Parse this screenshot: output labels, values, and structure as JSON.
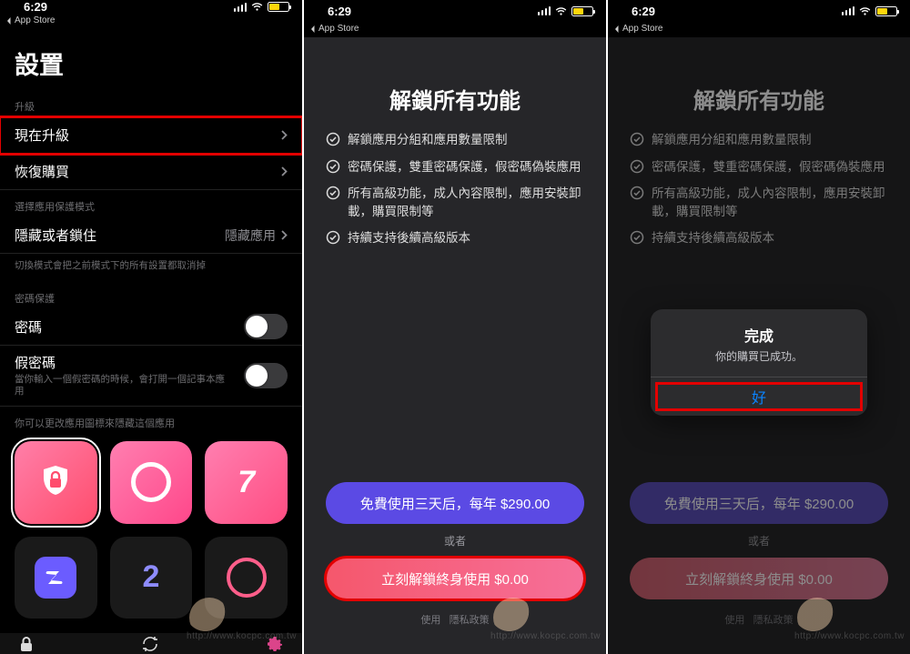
{
  "statusbar": {
    "time": "6:29",
    "back": "App Store"
  },
  "settings": {
    "title": "設置",
    "section_upgrade": "升級",
    "upgrade_now": "現在升級",
    "restore_purchase": "恢復購買",
    "section_mode": "選擇應用保護模式",
    "mode_label": "隱藏或者鎖住",
    "mode_value": "隱藏應用",
    "mode_footnote": "切換模式會把之前模式下的所有設置都取消掉",
    "section_passcode": "密碼保護",
    "passcode_label": "密碼",
    "fakecode_label": "假密碼",
    "fakecode_sub": "當你輸入一個假密碼的時候，會打開一個記事本應用",
    "section_disguise": "你可以更改應用圖標來隱藏這個應用",
    "icon3_glyph": "7",
    "icon5_glyph": "2"
  },
  "unlock": {
    "title": "解鎖所有功能",
    "features": [
      "解鎖應用分組和應用數量限制",
      "密碼保護，雙重密碼保護，假密碼偽裝應用",
      "所有高級功能，成人內容限制，應用安裝卸載，購買限制等",
      "持續支持後續高級版本"
    ],
    "trial_btn": "免費使用三天后，每年 $290.00",
    "or": "或者",
    "lifetime_btn": "立刻解鎖終身使用 $0.00",
    "footer_prefix": "使用",
    "footer_suffix": "隱私政策"
  },
  "alert": {
    "title": "完成",
    "message": "你的購買已成功。",
    "ok": "好"
  },
  "watermark": "http://www.kocpc.com.tw"
}
